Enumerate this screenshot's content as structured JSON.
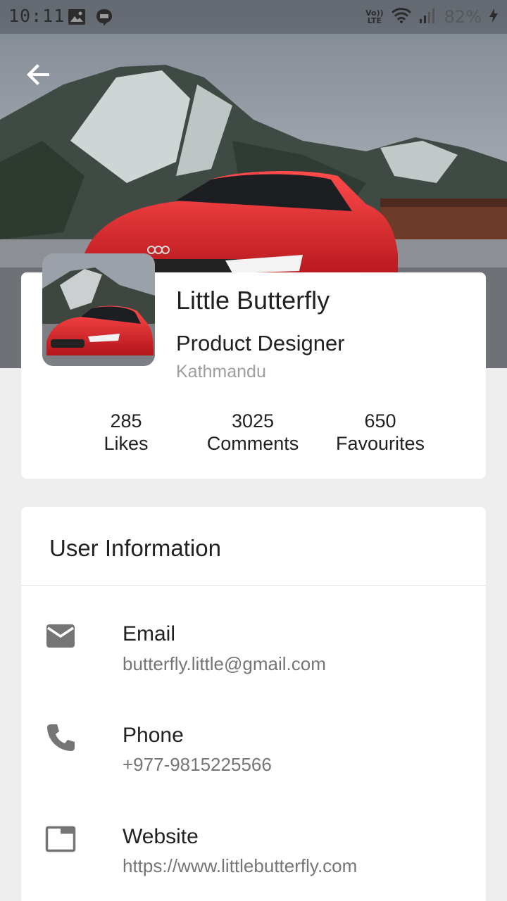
{
  "status_bar": {
    "time": "10:11",
    "network_label_top": "Vo))",
    "network_label_bottom": "LTE",
    "battery_text": "82%"
  },
  "profile": {
    "name": "Little Butterfly",
    "title": "Product Designer",
    "location": "Kathmandu",
    "stats": [
      {
        "value": "285",
        "label": "Likes"
      },
      {
        "value": "3025",
        "label": "Comments"
      },
      {
        "value": "650",
        "label": "Favourites"
      }
    ]
  },
  "user_info": {
    "title": "User Information",
    "items": [
      {
        "label": "Email",
        "value": "butterfly.little@gmail.com",
        "icon": "email-icon"
      },
      {
        "label": "Phone",
        "value": "+977-9815225566",
        "icon": "phone-icon"
      },
      {
        "label": "Website",
        "value": "https://www.littlebutterfly.com",
        "icon": "website-icon"
      }
    ]
  },
  "colors": {
    "background": "#eeeeee",
    "card": "#ffffff",
    "primary_text": "#212121",
    "secondary_text": "#757575",
    "hint_text": "#9e9e9e",
    "icon": "#757575",
    "car_red": "#d7262b"
  }
}
